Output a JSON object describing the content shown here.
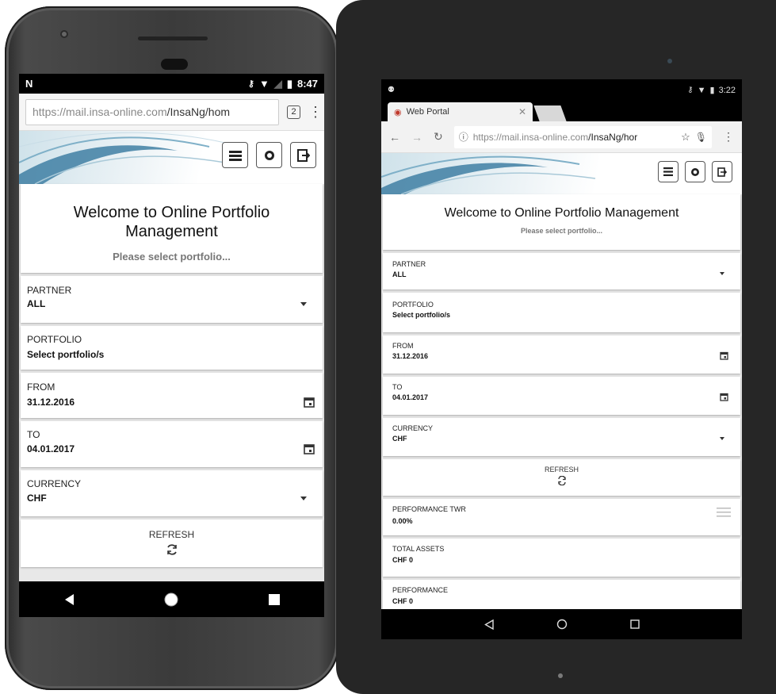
{
  "phone": {
    "status_time": "8:47",
    "status_left_icon": "n-icon",
    "url_host": "https://mail.insa-online.com",
    "url_path": "/InsaNg/hom",
    "tab_count": "2",
    "welcome_title": "Welcome to Online Portfolio Management",
    "welcome_subtitle": "Please select portfolio...",
    "fields": [
      {
        "label": "PARTNER",
        "value": "ALL"
      },
      {
        "label": "PORTFOLIO",
        "value": "Select portfolio/s"
      },
      {
        "label": "FROM",
        "value": "31.12.2016"
      },
      {
        "label": "TO",
        "value": "04.01.2017"
      },
      {
        "label": "CURRENCY",
        "value": "CHF"
      }
    ],
    "refresh_label": "REFRESH"
  },
  "tablet": {
    "status_time": "3:22",
    "tab_title": "Web Portal",
    "url_host": "https://mail.insa-online.com",
    "url_path": "/InsaNg/hor",
    "welcome_title": "Welcome to Online Portfolio Management",
    "welcome_subtitle": "Please select portfolio...",
    "fields": [
      {
        "label": "PARTNER",
        "value": "ALL"
      },
      {
        "label": "PORTFOLIO",
        "value": "Select portfolio/s"
      },
      {
        "label": "FROM",
        "value": "31.12.2016"
      },
      {
        "label": "TO",
        "value": "04.01.2017"
      },
      {
        "label": "CURRENCY",
        "value": "CHF"
      }
    ],
    "refresh_label": "REFRESH",
    "summary": [
      {
        "label": "PERFORMANCE TWR",
        "value": "0.00%"
      },
      {
        "label": "TOTAL ASSETS",
        "value": "CHF 0"
      },
      {
        "label": "PERFORMANCE",
        "value": "CHF 0"
      }
    ]
  },
  "colors": {
    "banner_blue": "#3f7fa3",
    "device_dark": "#3b3b3b"
  }
}
